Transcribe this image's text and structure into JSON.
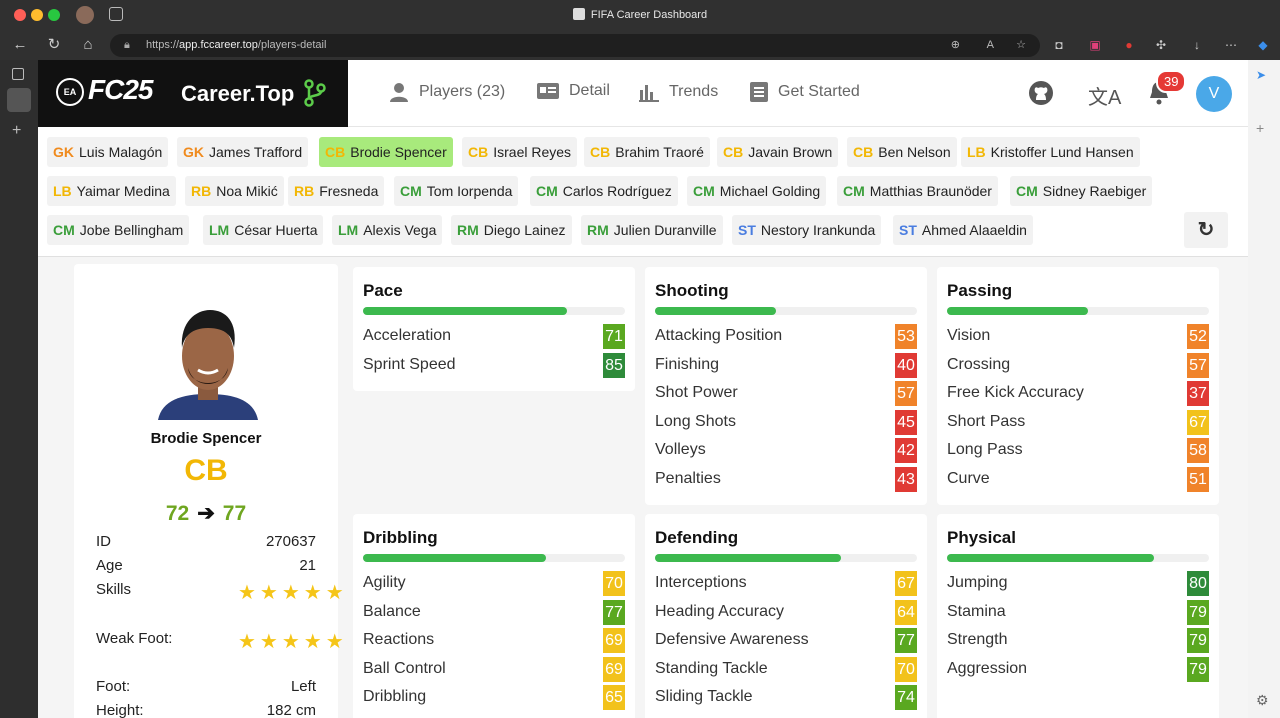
{
  "browser": {
    "tab_title": "FIFA Career Dashboard",
    "url_prefix": "https://",
    "url_domain": "app.fccareer.top",
    "url_path": "/players-detail"
  },
  "brand": {
    "ea": "EA",
    "fc": "FC25",
    "site": "Career.Top"
  },
  "nav": [
    {
      "label": "Players (23)",
      "icon": "person-icon"
    },
    {
      "label": "Detail",
      "icon": "id-card-icon"
    },
    {
      "label": "Trends",
      "icon": "bar-chart-icon"
    },
    {
      "label": "Get Started",
      "icon": "document-icon"
    }
  ],
  "notifications": {
    "count": "39"
  },
  "avatar": {
    "initial": "V"
  },
  "roster": [
    [
      {
        "pos": "GK",
        "name": "Luis Malagón"
      },
      {
        "pos": "GK",
        "name": "James Trafford"
      },
      {
        "pos": "CB",
        "name": "Brodie Spencer",
        "selected": true
      },
      {
        "pos": "CB",
        "name": "Israel Reyes"
      },
      {
        "pos": "CB",
        "name": "Brahim Traoré"
      },
      {
        "pos": "CB",
        "name": "Javain Brown"
      },
      {
        "pos": "CB",
        "name": "Ben Nelson"
      },
      {
        "pos": "LB",
        "name": "Kristoffer Lund Hansen"
      }
    ],
    [
      {
        "pos": "LB",
        "name": "Yaimar Medina"
      },
      {
        "pos": "RB",
        "name": "Noa Mikić"
      },
      {
        "pos": "RB",
        "name": "Fresneda"
      },
      {
        "pos": "CM",
        "name": "Tom Iorpenda"
      },
      {
        "pos": "CM",
        "name": "Carlos Rodríguez"
      },
      {
        "pos": "CM",
        "name": "Michael Golding"
      },
      {
        "pos": "CM",
        "name": "Matthias Braunöder"
      },
      {
        "pos": "CM",
        "name": "Sidney Raebiger"
      }
    ],
    [
      {
        "pos": "CM",
        "name": "Jobe Bellingham"
      },
      {
        "pos": "LM",
        "name": "César Huerta"
      },
      {
        "pos": "LM",
        "name": "Alexis Vega"
      },
      {
        "pos": "RM",
        "name": "Diego Lainez"
      },
      {
        "pos": "RM",
        "name": "Julien Duranville"
      },
      {
        "pos": "ST",
        "name": "Nestory Irankunda"
      },
      {
        "pos": "ST",
        "name": "Ahmed Alaaeldin"
      }
    ]
  ],
  "position_colors": {
    "GK": "#f08a1c",
    "CB": "#f2b705",
    "LB": "#f2b705",
    "RB": "#f2b705",
    "CM": "#3a9e3a",
    "LM": "#3a9e3a",
    "RM": "#3a9e3a",
    "ST": "#4a7de0"
  },
  "player": {
    "name": "Brodie Spencer",
    "position": "CB",
    "rating_now": "72",
    "rating_arrow": "➔",
    "rating_potential": "77",
    "details": [
      {
        "label": "ID",
        "value": "270637"
      },
      {
        "label": "Age",
        "value": "21"
      },
      {
        "label": "Skills",
        "stars": 5
      },
      {
        "label": "Weak Foot:",
        "stars": 5
      },
      {
        "label": "Foot:",
        "value": "Left"
      },
      {
        "label": "Height:",
        "value": "182 cm"
      }
    ]
  },
  "stat_colors": {
    "green_dark": "#2e8b3a",
    "green": "#5aa820",
    "yellow": "#f2c21b",
    "orange": "#f0832a",
    "red": "#e03a34"
  },
  "groups": [
    {
      "title": "Pace",
      "bar": 0.78,
      "stats": [
        {
          "label": "Acceleration",
          "value": 71,
          "color": "green"
        },
        {
          "label": "Sprint Speed",
          "value": 85,
          "color": "green_dark"
        }
      ]
    },
    {
      "title": "Shooting",
      "bar": 0.46,
      "stats": [
        {
          "label": "Attacking Position",
          "value": 53,
          "color": "orange"
        },
        {
          "label": "Finishing",
          "value": 40,
          "color": "red"
        },
        {
          "label": "Shot Power",
          "value": 57,
          "color": "orange"
        },
        {
          "label": "Long Shots",
          "value": 45,
          "color": "red"
        },
        {
          "label": "Volleys",
          "value": 42,
          "color": "red"
        },
        {
          "label": "Penalties",
          "value": 43,
          "color": "red"
        }
      ]
    },
    {
      "title": "Passing",
      "bar": 0.54,
      "stats": [
        {
          "label": "Vision",
          "value": 52,
          "color": "orange"
        },
        {
          "label": "Crossing",
          "value": 57,
          "color": "orange"
        },
        {
          "label": "Free Kick Accuracy",
          "value": 37,
          "color": "red"
        },
        {
          "label": "Short Pass",
          "value": 67,
          "color": "yellow"
        },
        {
          "label": "Long Pass",
          "value": 58,
          "color": "orange"
        },
        {
          "label": "Curve",
          "value": 51,
          "color": "orange"
        }
      ]
    },
    {
      "title": "Dribbling",
      "bar": 0.7,
      "stats": [
        {
          "label": "Agility",
          "value": 70,
          "color": "yellow"
        },
        {
          "label": "Balance",
          "value": 77,
          "color": "green"
        },
        {
          "label": "Reactions",
          "value": 69,
          "color": "yellow"
        },
        {
          "label": "Ball Control",
          "value": 69,
          "color": "yellow"
        },
        {
          "label": "Dribbling",
          "value": 65,
          "color": "yellow"
        }
      ]
    },
    {
      "title": "Defending",
      "bar": 0.71,
      "stats": [
        {
          "label": "Interceptions",
          "value": 67,
          "color": "yellow"
        },
        {
          "label": "Heading Accuracy",
          "value": 64,
          "color": "yellow"
        },
        {
          "label": "Defensive Awareness",
          "value": 77,
          "color": "green"
        },
        {
          "label": "Standing Tackle",
          "value": 70,
          "color": "yellow"
        },
        {
          "label": "Sliding Tackle",
          "value": 74,
          "color": "green"
        }
      ]
    },
    {
      "title": "Physical",
      "bar": 0.79,
      "stats": [
        {
          "label": "Jumping",
          "value": 80,
          "color": "green_dark"
        },
        {
          "label": "Stamina",
          "value": 79,
          "color": "green"
        },
        {
          "label": "Strength",
          "value": 79,
          "color": "green"
        },
        {
          "label": "Aggression",
          "value": 79,
          "color": "green"
        }
      ]
    }
  ]
}
